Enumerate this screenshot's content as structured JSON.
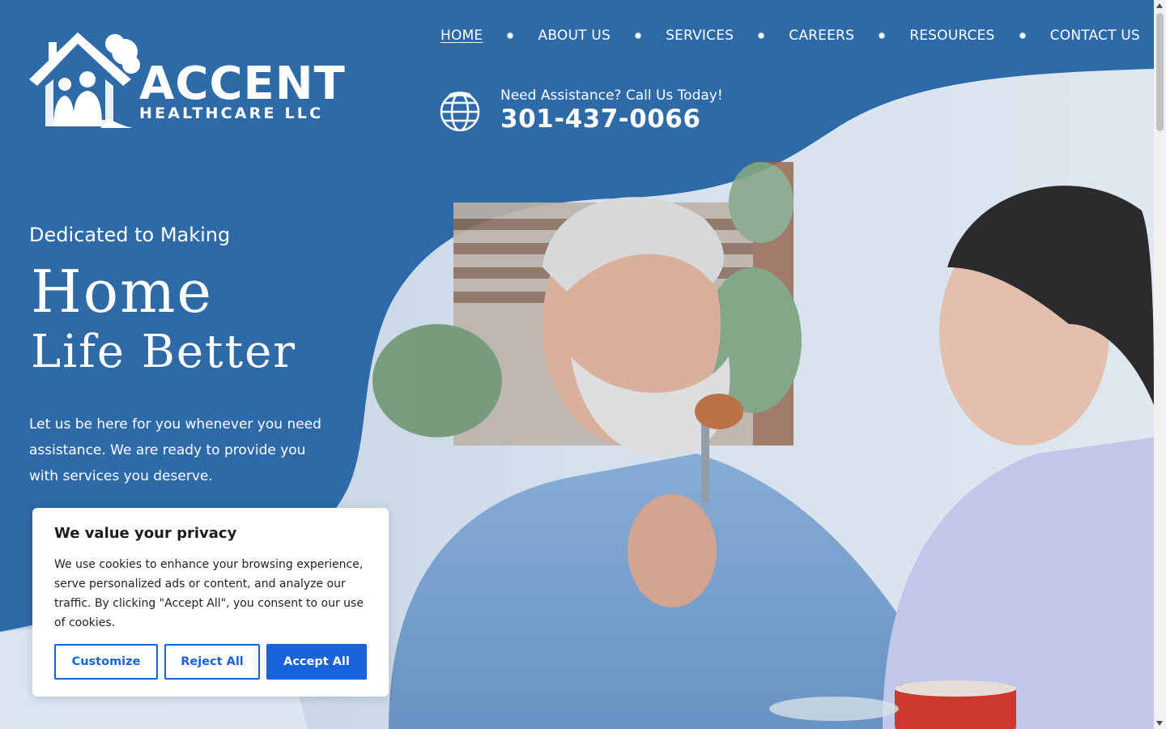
{
  "brand": {
    "name": "ACCENT",
    "subtitle": "HEALTHCARE LLC"
  },
  "nav": {
    "items": [
      {
        "label": "HOME",
        "active": true
      },
      {
        "label": "ABOUT US"
      },
      {
        "label": "SERVICES"
      },
      {
        "label": "CAREERS"
      },
      {
        "label": "RESOURCES"
      },
      {
        "label": "CONTACT US"
      }
    ]
  },
  "contact": {
    "label": "Need Assistance? Call Us Today!",
    "phone": "301-437-0066",
    "icon": "phone-globe-icon"
  },
  "hero": {
    "eyebrow": "Dedicated to Making",
    "line1": "Home",
    "line2": "Life Better",
    "lead": "Let us be here for you whenever you need assistance. We are ready to provide you with services you deserve."
  },
  "cookie": {
    "title": "We value your privacy",
    "body": "We use cookies to enhance your browsing experience, serve personalized ads or content, and analyze our traffic. By clicking \"Accept All\", you consent to our use of cookies.",
    "customize": "Customize",
    "reject": "Reject All",
    "accept": "Accept All"
  },
  "colors": {
    "brand_blue": "#2e6aa7",
    "button_blue": "#1863dc",
    "light_blue": "#dfe9f4"
  }
}
